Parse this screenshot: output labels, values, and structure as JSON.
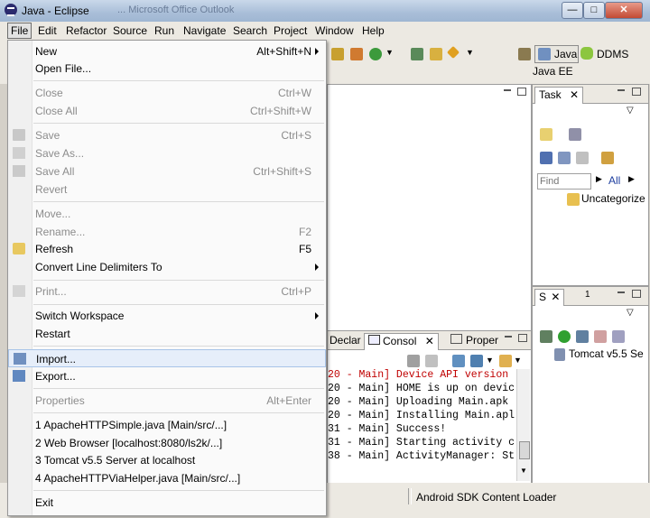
{
  "window": {
    "title": "Java - Eclipse",
    "bg_title": "...  Microsoft Office Outlook"
  },
  "menubar": [
    "File",
    "Edit",
    "Refactor",
    "Source",
    "Run",
    "Navigate",
    "Search",
    "Project",
    "Window",
    "Help"
  ],
  "perspectives": {
    "java": "Java",
    "ddms": "DDMS",
    "javaee": "Java EE"
  },
  "task_view": {
    "tab": "Task",
    "find_placeholder": "Find",
    "all": "All",
    "uncategorized": "Uncategorize"
  },
  "servers_view": {
    "tab": "S",
    "tab2": "1",
    "server": "Tomcat v5.5 Se"
  },
  "console_tabs": {
    "declar": "Declar",
    "console": "Consol",
    "proper": "Proper"
  },
  "console_lines": [
    {
      "text": "20 - Main] Device API version",
      "color": "#c00000"
    },
    {
      "text": "20 - Main] HOME is up on devic",
      "color": "#000000"
    },
    {
      "text": "20 - Main] Uploading Main.apk ",
      "color": "#000000"
    },
    {
      "text": "20 - Main] Installing Main.apl",
      "color": "#000000"
    },
    {
      "text": "31 - Main] Success!",
      "color": "#000000"
    },
    {
      "text": "31 - Main] Starting activity c",
      "color": "#000000"
    },
    {
      "text": "38 - Main] ActivityManager: St",
      "color": "#000000"
    }
  ],
  "statusbar": {
    "loader": "Android SDK Content Loader"
  },
  "file_menu": {
    "items": [
      {
        "label": "New",
        "accel": "Alt+Shift+N",
        "submenu": true,
        "disabled": false
      },
      {
        "label": "Open File...",
        "accel": "",
        "disabled": false
      },
      {
        "label": "Close",
        "accel": "Ctrl+W",
        "disabled": true
      },
      {
        "label": "Close All",
        "accel": "Ctrl+Shift+W",
        "disabled": true
      },
      {
        "label": "Save",
        "accel": "Ctrl+S",
        "disabled": true,
        "icon": "save-icon"
      },
      {
        "label": "Save As...",
        "accel": "",
        "disabled": true,
        "icon": "save-as-icon"
      },
      {
        "label": "Save All",
        "accel": "Ctrl+Shift+S",
        "disabled": true,
        "icon": "save-all-icon"
      },
      {
        "label": "Revert",
        "accel": "",
        "disabled": true
      },
      {
        "label": "Move...",
        "accel": "",
        "disabled": true
      },
      {
        "label": "Rename...",
        "accel": "F2",
        "disabled": true
      },
      {
        "label": "Refresh",
        "accel": "F5",
        "disabled": false,
        "icon": "refresh-icon"
      },
      {
        "label": "Convert Line Delimiters To",
        "accel": "",
        "submenu": true,
        "disabled": false
      },
      {
        "label": "Print...",
        "accel": "Ctrl+P",
        "disabled": true,
        "icon": "print-icon"
      },
      {
        "label": "Switch Workspace",
        "accel": "",
        "submenu": true,
        "disabled": false
      },
      {
        "label": "Restart",
        "accel": "",
        "disabled": false
      },
      {
        "label": "Import...",
        "accel": "",
        "disabled": false,
        "icon": "import-icon",
        "highlighted": true
      },
      {
        "label": "Export...",
        "accel": "",
        "disabled": false,
        "icon": "export-icon"
      },
      {
        "label": "Properties",
        "accel": "Alt+Enter",
        "disabled": true
      },
      {
        "label": "1 ApacheHTTPSimple.java  [Main/src/...]",
        "accel": "",
        "disabled": false
      },
      {
        "label": "2 Web Browser  [localhost:8080/ls2k/...]",
        "accel": "",
        "disabled": false
      },
      {
        "label": "3 Tomcat v5.5 Server at localhost",
        "accel": "",
        "disabled": false
      },
      {
        "label": "4 ApacheHTTPViaHelper.java  [Main/src/...]",
        "accel": "",
        "disabled": false
      },
      {
        "label": "Exit",
        "accel": "",
        "disabled": false
      }
    ]
  }
}
